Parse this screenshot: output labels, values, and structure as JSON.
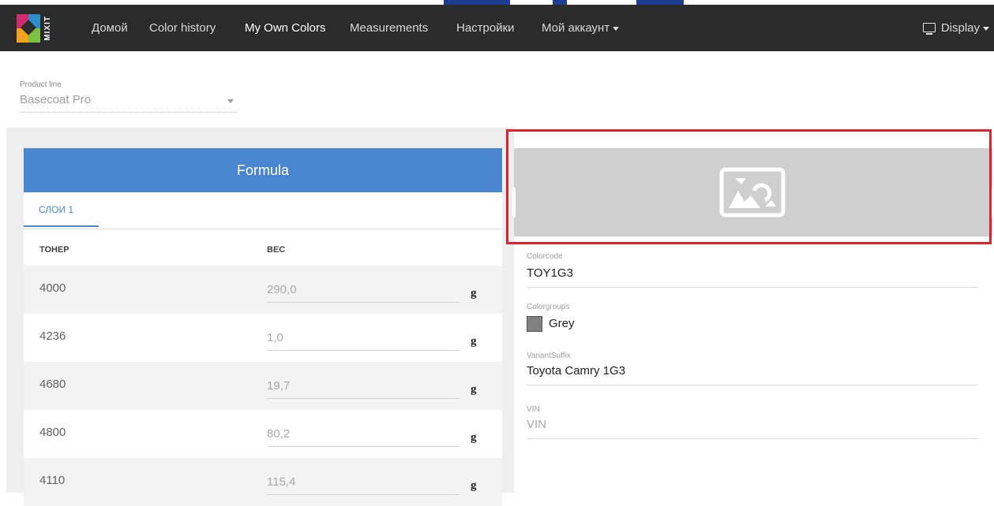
{
  "colors": {
    "navbar_bg": "#2b2b2b",
    "formula_header": "#4a86d0",
    "highlight_border": "#d9232d",
    "swatch_grey": "#808080"
  },
  "logo": {
    "text": "MIXIT",
    "icon": "mixit-logo-icon"
  },
  "nav": {
    "items": [
      "Домой",
      "Color history",
      "My Own Colors",
      "Measurements",
      "Настройки",
      "Мой аккаунт"
    ],
    "active": "My Own Colors",
    "display_label": "Display"
  },
  "product_line": {
    "label": "Product line",
    "value": "Basecoat Pro"
  },
  "formula": {
    "title": "Formula",
    "tab_label": "СЛОИ 1",
    "col_toner": "ТОНЕР",
    "col_weight": "ВЕС",
    "rows": [
      {
        "toner": "4000",
        "weight": "290,0",
        "unit": "g"
      },
      {
        "toner": "4236",
        "weight": "1,0",
        "unit": "g"
      },
      {
        "toner": "4680",
        "weight": "19,7",
        "unit": "g"
      },
      {
        "toner": "4800",
        "weight": "80,2",
        "unit": "g"
      },
      {
        "toner": "4110",
        "weight": "115,4",
        "unit": "g"
      }
    ]
  },
  "details": {
    "image_icon": "image-placeholder-icon",
    "colorcode_label": "Colorcode",
    "colorcode_value": "TOY1G3",
    "colorgroups_label": "Colorgroups",
    "colorgroups_value": "Grey",
    "variant_label": "VariantSuffix",
    "variant_value": "Toyota Camry 1G3",
    "vin_label": "VIN",
    "vin_placeholder": "VIN"
  }
}
